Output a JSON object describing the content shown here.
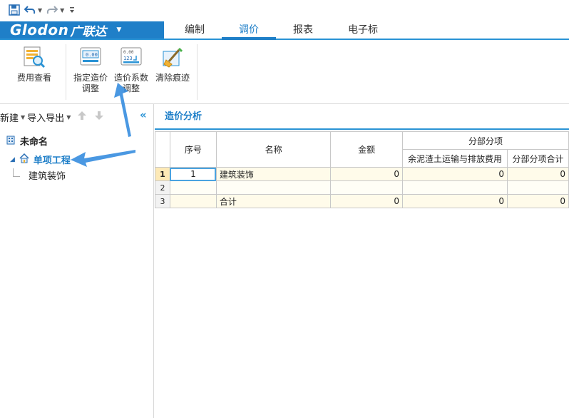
{
  "quick_access": {
    "icons": [
      "save-icon",
      "undo-icon",
      "redo-icon",
      "customize-icon"
    ]
  },
  "brand": {
    "logo": "Glodon",
    "name": "广联达"
  },
  "ribbon_tabs": [
    {
      "label": "编制",
      "active": false
    },
    {
      "label": "调价",
      "active": true
    },
    {
      "label": "报表",
      "active": false
    },
    {
      "label": "电子标",
      "active": false
    }
  ],
  "ribbon_buttons": {
    "fee_view": "费用查看",
    "designated_adjust_l1": "指定造价",
    "designated_adjust_l2": "调整",
    "coefficient_adjust_l1": "造价系数",
    "coefficient_adjust_l2": "调整",
    "clear_traces": "清除痕迹"
  },
  "left_toolbar": {
    "new_label": "新建",
    "import_export_label": "导入导出"
  },
  "tree": {
    "root": "未命名",
    "child": "单项工程",
    "leaf": "建筑装饰"
  },
  "panel_tab": "造价分析",
  "table": {
    "headers": {
      "seq": "序号",
      "name": "名称",
      "amount": "金额",
      "group": "分部分项",
      "sub1": "余泥渣土运输与排放费用",
      "sub2": "分部分项合计"
    },
    "rows": [
      {
        "rownum": "1",
        "seq": "1",
        "name": "建筑装饰",
        "amount": "0",
        "sub1": "0",
        "sub2": "0"
      },
      {
        "rownum": "2",
        "seq": "",
        "name": "",
        "amount": "",
        "sub1": "",
        "sub2": ""
      },
      {
        "rownum": "3",
        "seq": "",
        "name": "合计",
        "amount": "0",
        "sub1": "0",
        "sub2": "0"
      }
    ]
  },
  "colors": {
    "brand_blue": "#1f7fc8",
    "accent_blue": "#2a93d5",
    "header_highlight": "#fbe8b5",
    "row_fill": "#fffbea",
    "annotation_arrow": "#3b8fe0"
  }
}
